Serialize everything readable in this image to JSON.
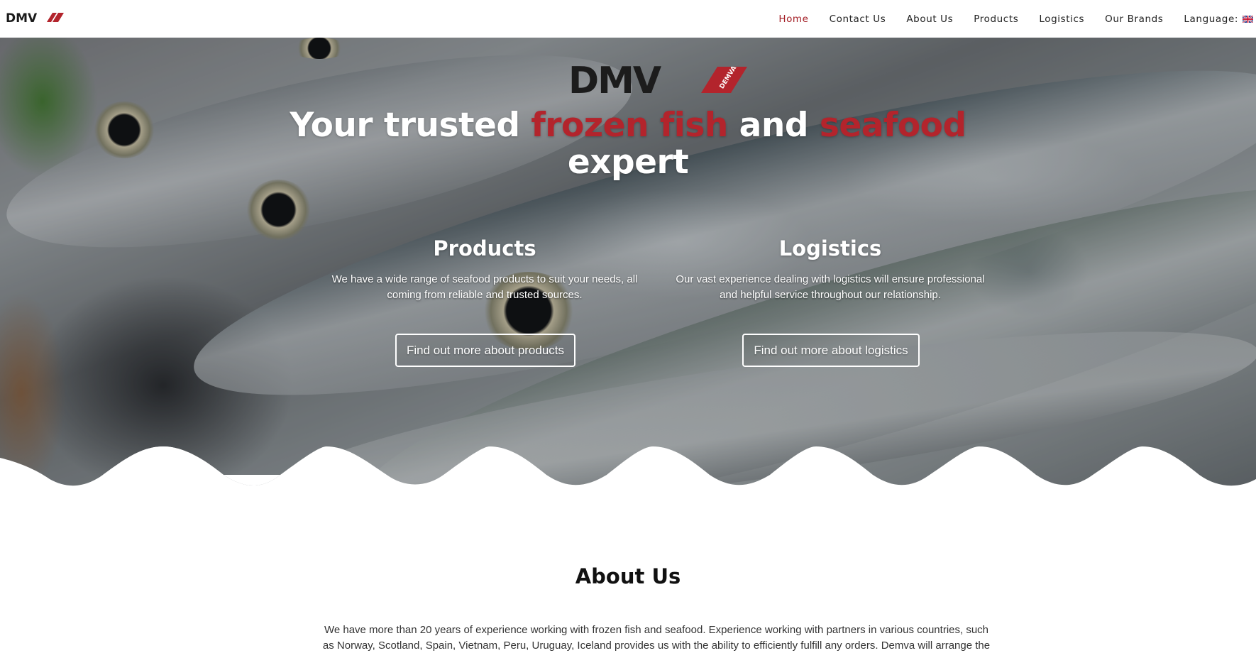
{
  "nav": {
    "logo_text": "DMV",
    "links": [
      "Home",
      "Contact Us",
      "About Us",
      "Products",
      "Logistics",
      "Our Brands"
    ],
    "active": "Home",
    "language_label": "Language:",
    "language_icon": "uk-flag-icon"
  },
  "hero": {
    "logo_text": "DMV",
    "logo_badge": "DEMVA",
    "title_part1": "Your trusted ",
    "title_red1": "frozen fish",
    "title_part2": " and ",
    "title_red2": "seafood",
    "title_part3": "expert",
    "products": {
      "heading": "Products",
      "text": "We have a wide range of seafood products to suit your needs, all coming from reliable and trusted sources.",
      "button": "Find out more about products"
    },
    "logistics": {
      "heading": "Logistics",
      "text": "Our vast experience dealing with logistics will ensure professional and helpful service throughout our relationship.",
      "button": "Find out more about logistics"
    }
  },
  "about": {
    "title": "About Us",
    "text": "We have more than 20 years of experience working with frozen fish and seafood. Experience working with partners in various countries, such as Norway, Scotland, Spain, Vietnam, Peru, Uruguay, Iceland provides us with the ability to efficiently fulfill any orders. Demva will arrange the"
  },
  "colors": {
    "brand_red": "#b3242c",
    "active_nav": "#a31d24",
    "text_dark": "#222222"
  }
}
